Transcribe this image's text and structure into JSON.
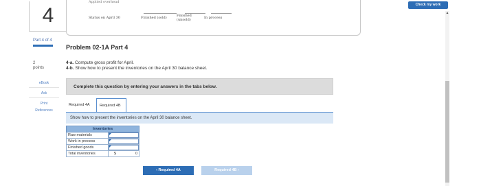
{
  "header": {
    "check_my_work": "Check my work"
  },
  "left_rail": {
    "question_number": "4",
    "part_label": "Part 4 of 4",
    "points_value": "2",
    "points_label": "points",
    "links": [
      "eBook",
      "Ask",
      "Print",
      "References"
    ]
  },
  "top_card": {
    "cut_text": "Applied overhead",
    "row_label": "Status on April 30",
    "columns": [
      "Finished (sold)",
      "Finished (unsold)",
      "In process"
    ]
  },
  "problem": {
    "title": "Problem 02-1A Part 4",
    "task_a_prefix": "4-a.",
    "task_a_text": " Compute gross profit for April.",
    "task_b_prefix": "4-b.",
    "task_b_text": " Show how to present the inventories on the April 30 balance sheet."
  },
  "instructions": "Complete this question by entering your answers in the tabs below.",
  "tabs": [
    {
      "label": "Required 4A",
      "active": false
    },
    {
      "label": "Required 4B",
      "active": true
    }
  ],
  "subheader": "Show how to present the inventories on the April 30 balance sheet.",
  "inventories_table": {
    "header": "Inventories",
    "rows": [
      {
        "label": "Raw materials",
        "value": ""
      },
      {
        "label": "Work in process",
        "value": ""
      },
      {
        "label": "Finished goods",
        "value": ""
      },
      {
        "label": "Total inventories",
        "currency": "$",
        "value": "0"
      }
    ]
  },
  "nav": {
    "prev_label": "‹  Required 4A",
    "next_label": "Required 4B  ›"
  }
}
